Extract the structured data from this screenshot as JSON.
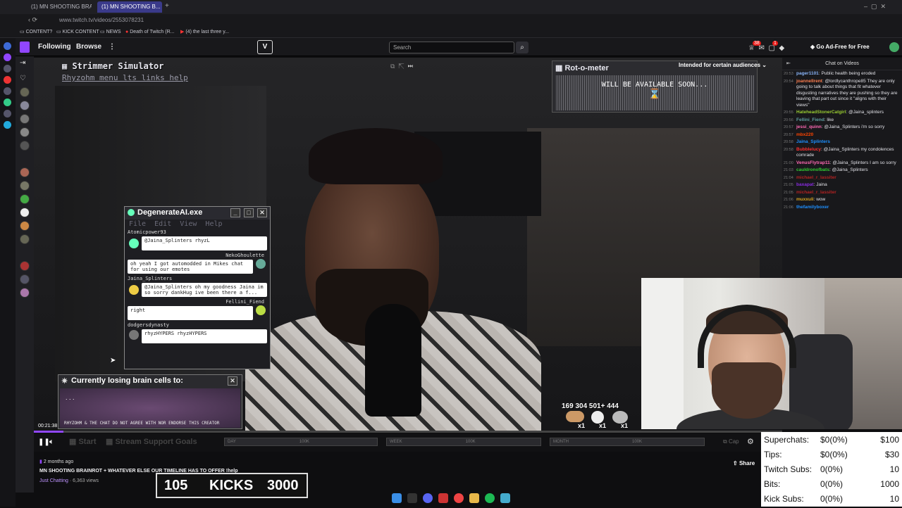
{
  "browser": {
    "tabs": [
      "(1) MN SHOOTING BRAIN...",
      "(1) MN SHOOTING B..."
    ],
    "url": "www.twitch.tv/videos/2553078231",
    "bookmarks": [
      "CONTENT?",
      "KICK CONTENT",
      "NEWS",
      "Death of Twitch (R...",
      "(4) the last three y..."
    ]
  },
  "nav": {
    "following": "Following",
    "browse": "Browse",
    "more": "⋮",
    "search_placeholder": "Search",
    "notif_badge_1": "38",
    "notif_badge_2": "1",
    "ad_free": "Go Ad-Free for Free"
  },
  "overlay": {
    "title": "Strimmer Simulator",
    "menu": "Rhyzohm menu lts links help",
    "rot_title": "Rot-o-meter",
    "rot_text": "WILL BE AVAILABLE SOON...",
    "audience": "Intended for certain audiences",
    "degen": {
      "title": "DegenerateAI.exe",
      "menu": [
        "File",
        "Edit",
        "View",
        "Help"
      ],
      "messages": [
        {
          "name": "Atomicpower93",
          "text": "@Jaina_Splinters rhyzL",
          "side": "left"
        },
        {
          "name": "NekoGhoulette",
          "text": "oh yeah I got automodded in Mikes chat for using our emotes",
          "side": "right"
        },
        {
          "name": "Jaina_Splinters",
          "text": "@Jaina_Splinters oh my goodness Jaina im so sorry dankHug ive been there a f...",
          "side": "left"
        },
        {
          "name": "Fellini_Fiend",
          "text": "right",
          "side": "right"
        },
        {
          "name": "dodgersdynasty",
          "text": "rhyzHYPERS rhyzHYPERS",
          "side": "left"
        }
      ]
    },
    "brain": {
      "title": "Currently losing brain cells to:",
      "dots": ". . .",
      "disclaimer": "RHYZOHM & THE CHAT DO NOT AGREE WITH NOR ENDORSE THIS CREATOR"
    },
    "counts": "169  304  501+ 444",
    "multipliers": [
      "x1",
      "x1",
      "x1"
    ],
    "goals": {
      "start": "Start",
      "title": "Stream Support Goals",
      "labels": [
        "DAY",
        "100K",
        "WEEK",
        "100K",
        "MONTH",
        "100K"
      ],
      "cap": "Cap"
    }
  },
  "player": {
    "time": "00:21:38",
    "progress": 0.04
  },
  "video": {
    "age": "2 months ago",
    "title": "MN SHOOTING BRAINROT + WHATEVER ELSE OUR TIMELINE HAS TO OFFER !help",
    "category": "Just Chatting",
    "views": "6,363 views",
    "share": "Share"
  },
  "chat": {
    "header": "Chat on Videos",
    "messages": [
      {
        "time": "20:53",
        "user": "pager1101",
        "color": "#8ab4f8",
        "text": "Public health being eroded"
      },
      {
        "time": "20:54",
        "user": "joannellrent",
        "color": "#ff7f50",
        "text": "@lordlycanthrope85 They are only going to talk about things that fit whatever disgusting narratives they are pushing so they are leaving that part out since it \"aligns with their views\""
      },
      {
        "time": "20:55",
        "user": "HateheadStonerCatgirl",
        "color": "#9acd32",
        "text": "@Jaina_splinters"
      },
      {
        "time": "20:56",
        "user": "Fellini_Fiend",
        "color": "#5f9ea0",
        "text": "like"
      },
      {
        "time": "20:57",
        "user": "jessi_quinn",
        "color": "#ff69b4",
        "text": "@Jaina_Splinters i'm so sorry"
      },
      {
        "time": "20:57",
        "user": "mbx220",
        "color": "#ff4500",
        "text": ""
      },
      {
        "time": "20:58",
        "user": "Jaina_Splinters",
        "color": "#1e90ff",
        "text": ""
      },
      {
        "time": "20:58",
        "user": "Bubblelucy",
        "color": "#ff3030",
        "text": "@Jaina_Splinters my condolences comrade"
      },
      {
        "time": "21:00",
        "user": "VenusFlytrap11",
        "color": "#ff69b4",
        "text": "@Jaina_Splinters I am so sorry"
      },
      {
        "time": "21:03",
        "user": "cauldronofbats",
        "color": "#32cd32",
        "text": "@Jaina_Splinters"
      },
      {
        "time": "21:04",
        "user": "michael_r_lassiter",
        "color": "#b22222",
        "text": ""
      },
      {
        "time": "21:05",
        "user": "baxapat",
        "color": "#8a2be2",
        "text": "Jaina"
      },
      {
        "time": "21:05",
        "user": "michael_r_lassiter",
        "color": "#b22222",
        "text": ""
      },
      {
        "time": "21:06",
        "user": "muxxuli",
        "color": "#daa520",
        "text": "wow"
      },
      {
        "time": "21:06",
        "user": "thefamilyboxer",
        "color": "#1e90ff",
        "text": ""
      }
    ]
  },
  "donations": [
    {
      "label": "Superchats:",
      "value": "$0(0%)",
      "goal": "$100"
    },
    {
      "label": "Tips:",
      "value": "$0(0%)",
      "goal": "$30"
    },
    {
      "label": "Twitch Subs:",
      "value": "0(0%)",
      "goal": "10"
    },
    {
      "label": "Bits:",
      "value": "0(0%)",
      "goal": "1000"
    },
    {
      "label": "Kick Subs:",
      "value": "0(0%)",
      "goal": "10"
    }
  ],
  "kicks": {
    "count": "105",
    "label": "KICKS",
    "goal": "3000"
  },
  "colors": {
    "accent": "#9147ff",
    "twitch_purple": "#9146ff"
  }
}
